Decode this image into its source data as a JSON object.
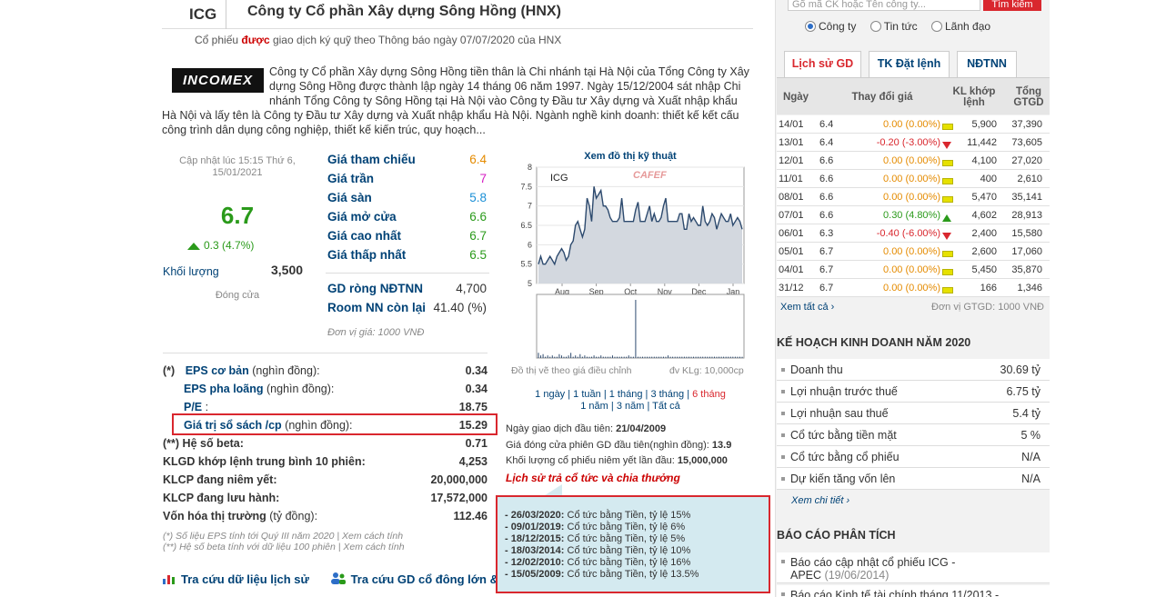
{
  "header": {
    "ticker": "ICG",
    "company": "Công ty Cổ phần Xây dựng Sông Hồng (HNX)",
    "notice_pre": "Cổ phiếu",
    "notice_red": "được",
    "notice_post": "giao dịch ký quỹ theo Thông báo ngày 07/07/2020 của HNX"
  },
  "logo_text": "INCOMEX",
  "description": "Công ty Cổ phần Xây dựng Sông Hồng tiền thân là Chi nhánh tại Hà Nội của Tổng Công ty Xây dựng Sông Hồng được thành lập ngày 14 tháng 06 năm 1997. Ngày 15/12/2004 sát nhập Chi nhánh Tổng Công ty Sông Hồng tại Hà Nội vào Công ty Đầu tư Xây dựng và Xuất nhập khẩu Hà Nội và lấy tên là Công ty Đầu tư Xây dựng và Xuất nhập khẩu Hà Nội. Ngành nghề kinh doanh: thiết kế kết cấu công trình dân dụng công nghiệp, thiết kế kiến trúc, quy hoạch...",
  "quote": {
    "updated": "Cập nhật lúc 15:15 Thứ 6, 15/01/2021",
    "price": "6.7",
    "change": "0.3 (4.7%)",
    "volume_label": "Khối lượng",
    "volume": "3,500",
    "status": "Đóng cửa"
  },
  "prices": [
    {
      "label": "Giá tham chiếu",
      "value": "6.4",
      "color": "#e58b00"
    },
    {
      "label": "Giá trần",
      "value": "7",
      "color": "#d61cc2"
    },
    {
      "label": "Giá sàn",
      "value": "5.8",
      "color": "#1a8fd6"
    },
    {
      "label": "Giá mở cửa",
      "value": "6.6",
      "color": "#2a9a1a"
    },
    {
      "label": "Giá cao nhất",
      "value": "6.7",
      "color": "#2a9a1a"
    },
    {
      "label": "Giá thấp nhất",
      "value": "6.5",
      "color": "#2a9a1a"
    }
  ],
  "foreign": [
    {
      "label": "GD ròng NĐTNN",
      "value": "4,700"
    },
    {
      "label": "Room NN còn lại",
      "value": "41.40 (%)"
    }
  ],
  "unit_note": "Đơn vị giá: 1000 VNĐ",
  "financials": [
    {
      "prefix": "(*)",
      "label": "EPS",
      "suffix": "cơ bản",
      "paren": "(nghìn đồng):",
      "value": "0.34"
    },
    {
      "prefix": "",
      "label": "EPS",
      "suffix": "pha loãng",
      "paren": "(nghìn đồng):",
      "value": "0.34"
    },
    {
      "prefix": "",
      "label": "P/E",
      "suffix": "",
      "paren": ":",
      "value": "18.75"
    },
    {
      "prefix": "",
      "label": "Giá trị sổ sách /cp",
      "suffix": "",
      "paren": "(nghìn đồng):",
      "value": "15.29"
    },
    {
      "prefix": "(**)",
      "label": "Hệ số beta:",
      "suffix": "",
      "paren": "",
      "value": "0.71"
    },
    {
      "prefix": "",
      "label": "KLGD khớp lệnh trung bình 10 phiên:",
      "suffix": "",
      "paren": "",
      "value": "4,253"
    },
    {
      "prefix": "",
      "label": "KLCP đang niêm yết:",
      "suffix": "",
      "paren": "",
      "value": "20,000,000"
    },
    {
      "prefix": "",
      "label": "KLCP đang lưu hành:",
      "suffix": "",
      "paren": "",
      "value": "17,572,000"
    },
    {
      "prefix": "",
      "label": "Vốn hóa thị trường",
      "suffix": "",
      "paren": "(tỷ đồng):",
      "value": "112.46"
    }
  ],
  "notes": [
    "(*) Số liệu EPS tính tới Quý III năm 2020 | Xem cách tính",
    "(**) Hệ số beta tính với dữ liệu 100 phiên | Xem cách tính"
  ],
  "bottom_links": [
    "Tra cứu dữ liệu lịch sử",
    "Tra cứu GD cổ đông lớn & c"
  ],
  "chart_header": "Xem đồ thị kỹ thuật",
  "chart_data": {
    "type": "line",
    "label": "ICG",
    "watermark": "CAFEF",
    "x_ticks": [
      "Aug",
      "Sep",
      "Oct",
      "Nov",
      "Dec",
      "Jan"
    ],
    "y_ticks": [
      5,
      5.5,
      6,
      6.5,
      7,
      7.5,
      8
    ],
    "ylim": [
      5,
      8
    ],
    "price_series": [
      5.5,
      5.7,
      5.5,
      5.5,
      5.6,
      5.7,
      5.6,
      5.5,
      5.7,
      5.8,
      5.9,
      5.8,
      5.6,
      5.7,
      6.0,
      6.1,
      6.5,
      6.6,
      6.4,
      6.2,
      6.4,
      7.2,
      7.0,
      6.6,
      7.5,
      7.2,
      7.3,
      7.4,
      7.0,
      7.0,
      6.9,
      6.7,
      6.6,
      6.6,
      6.6,
      6.7,
      7.2,
      6.6,
      6.6,
      6.6,
      6.6,
      6.6,
      6.9,
      7.1,
      6.6,
      6.6,
      6.6,
      6.8,
      7.0,
      6.6,
      6.8,
      6.6,
      6.6,
      6.7,
      7.0,
      7.2,
      6.6,
      6.6,
      6.6,
      6.6,
      6.6,
      6.8,
      6.8,
      6.4,
      6.4,
      6.8,
      6.6,
      6.7,
      6.6,
      6.5,
      6.5,
      7.0,
      6.6,
      6.5,
      6.6,
      6.8,
      6.7,
      6.4,
      6.6,
      6.8,
      6.7,
      6.6,
      6.6,
      6.8,
      6.5,
      6.6,
      6.7,
      6.6,
      6.4
    ],
    "volume_series": [
      4,
      2,
      3,
      1,
      2,
      1,
      2,
      1,
      1,
      3,
      2,
      1,
      1,
      2,
      4,
      1,
      2,
      1,
      3,
      1,
      2,
      1,
      1,
      1,
      2,
      1,
      1,
      2,
      1,
      1,
      1,
      1,
      2,
      1,
      1,
      1,
      1,
      1,
      1,
      2,
      1,
      1,
      45,
      1,
      1,
      1,
      1,
      1,
      1,
      1,
      1,
      1,
      1,
      1,
      1,
      1,
      2,
      1,
      1,
      1,
      1,
      1,
      1,
      1,
      1,
      1,
      1,
      1,
      1,
      1,
      1,
      1,
      1,
      1,
      1,
      1,
      1,
      1,
      1,
      1,
      1,
      1,
      1,
      1,
      1,
      1,
      1,
      1,
      1
    ],
    "volume_axis_label": "đv KLg: 10,000cp",
    "xlabel": "",
    "ylabel": ""
  },
  "chart_note": "Đồ thị vẽ theo giá điều chỉnh",
  "periods_line1": [
    "1 ngày",
    "1 tuần",
    "1 tháng",
    "3 tháng",
    "6 tháng"
  ],
  "periods_line2": [
    "1 năm",
    "3 năm",
    "Tất cả"
  ],
  "first_trade": {
    "date_label": "Ngày giao dịch đầu tiên:",
    "date": "21/04/2009",
    "close_label": "Giá đóng cửa phiên GD đầu tiên(nghìn đồng):",
    "close": "13.9",
    "vol_label": "Khối lượng cổ phiếu niêm yết lần đầu:",
    "vol": "15,000,000"
  },
  "dividend_link": "Lịch sử trả cổ tức và chia thưởng",
  "dividends": [
    {
      "date": "- 26/03/2020:",
      "text": "Cổ tức bằng Tiền, tỷ lệ 15%"
    },
    {
      "date": "- 09/01/2019:",
      "text": "Cổ tức bằng Tiền, tỷ lệ 6%"
    },
    {
      "date": "- 18/12/2015:",
      "text": "Cổ tức bằng Tiền, tỷ lệ 5%"
    },
    {
      "date": "- 18/03/2014:",
      "text": "Cổ tức bằng Tiền, tỷ lệ 10%"
    },
    {
      "date": "- 12/02/2010:",
      "text": "Cổ tức bằng Tiền, tỷ lệ 16%"
    },
    {
      "date": "- 15/05/2009:",
      "text": "Cổ tức bằng Tiền, tỷ lệ 13.5%"
    }
  ],
  "sidebar": {
    "search_placeholder": "Gõ mã CK hoặc Tên công ty...",
    "search_button": "Tìm kiếm",
    "radios": [
      "Công ty",
      "Tin tức",
      "Lãnh đạo"
    ],
    "tabs": [
      "Lịch sử GD",
      "TK Đặt lệnh",
      "NĐTNN"
    ],
    "table_headers": [
      "Ngày",
      "Thay đổi giá",
      "KL khớp lệnh",
      "Tổng GTGD"
    ],
    "rows": [
      {
        "date": "14/01",
        "price": "6.4",
        "change": "0.00 (0.00%)",
        "dir": "ref",
        "vol": "5,900",
        "value": "37,390"
      },
      {
        "date": "13/01",
        "price": "6.4",
        "change": "-0.20 (-3.00%)",
        "dir": "down",
        "vol": "11,442",
        "value": "73,605"
      },
      {
        "date": "12/01",
        "price": "6.6",
        "change": "0.00 (0.00%)",
        "dir": "ref",
        "vol": "4,100",
        "value": "27,020"
      },
      {
        "date": "11/01",
        "price": "6.6",
        "change": "0.00 (0.00%)",
        "dir": "ref",
        "vol": "400",
        "value": "2,610"
      },
      {
        "date": "08/01",
        "price": "6.6",
        "change": "0.00 (0.00%)",
        "dir": "ref",
        "vol": "5,470",
        "value": "35,141"
      },
      {
        "date": "07/01",
        "price": "6.6",
        "change": "0.30 (4.80%)",
        "dir": "up",
        "vol": "4,602",
        "value": "28,913"
      },
      {
        "date": "06/01",
        "price": "6.3",
        "change": "-0.40 (-6.00%)",
        "dir": "down",
        "vol": "2,400",
        "value": "15,580"
      },
      {
        "date": "05/01",
        "price": "6.7",
        "change": "0.00 (0.00%)",
        "dir": "ref",
        "vol": "2,600",
        "value": "17,060"
      },
      {
        "date": "04/01",
        "price": "6.7",
        "change": "0.00 (0.00%)",
        "dir": "ref",
        "vol": "5,450",
        "value": "35,870"
      },
      {
        "date": "31/12",
        "price": "6.7",
        "change": "0.00 (0.00%)",
        "dir": "ref",
        "vol": "166",
        "value": "1,346"
      }
    ],
    "see_all": "Xem tất cả",
    "unit": "Đơn vị GTGD: 1000 VNĐ",
    "plan_title": "KẾ HOẠCH KINH DOANH NĂM 2020",
    "plan": [
      {
        "label": "Doanh thu",
        "value": "30.69 tỷ"
      },
      {
        "label": "Lợi nhuận trước thuế",
        "value": "6.75 tỷ"
      },
      {
        "label": "Lợi nhuận sau thuế",
        "value": "5.4 tỷ"
      },
      {
        "label": "Cổ tức bằng tiền mặt",
        "value": "5 %"
      },
      {
        "label": "Cổ tức bằng cổ phiếu",
        "value": "N/A"
      },
      {
        "label": "Dự kiến tăng vốn lên",
        "value": "N/A"
      }
    ],
    "plan_more": "Xem chi tiết",
    "report_title": "BÁO CÁO PHÂN TÍCH",
    "report1_a": "Báo cáo cập nhật cổ phiếu ICG -",
    "report1_b": "APEC",
    "report1_date": "(19/06/2014)",
    "report2": "Báo cáo Kinh tế tài chính tháng 11/2013 -"
  }
}
